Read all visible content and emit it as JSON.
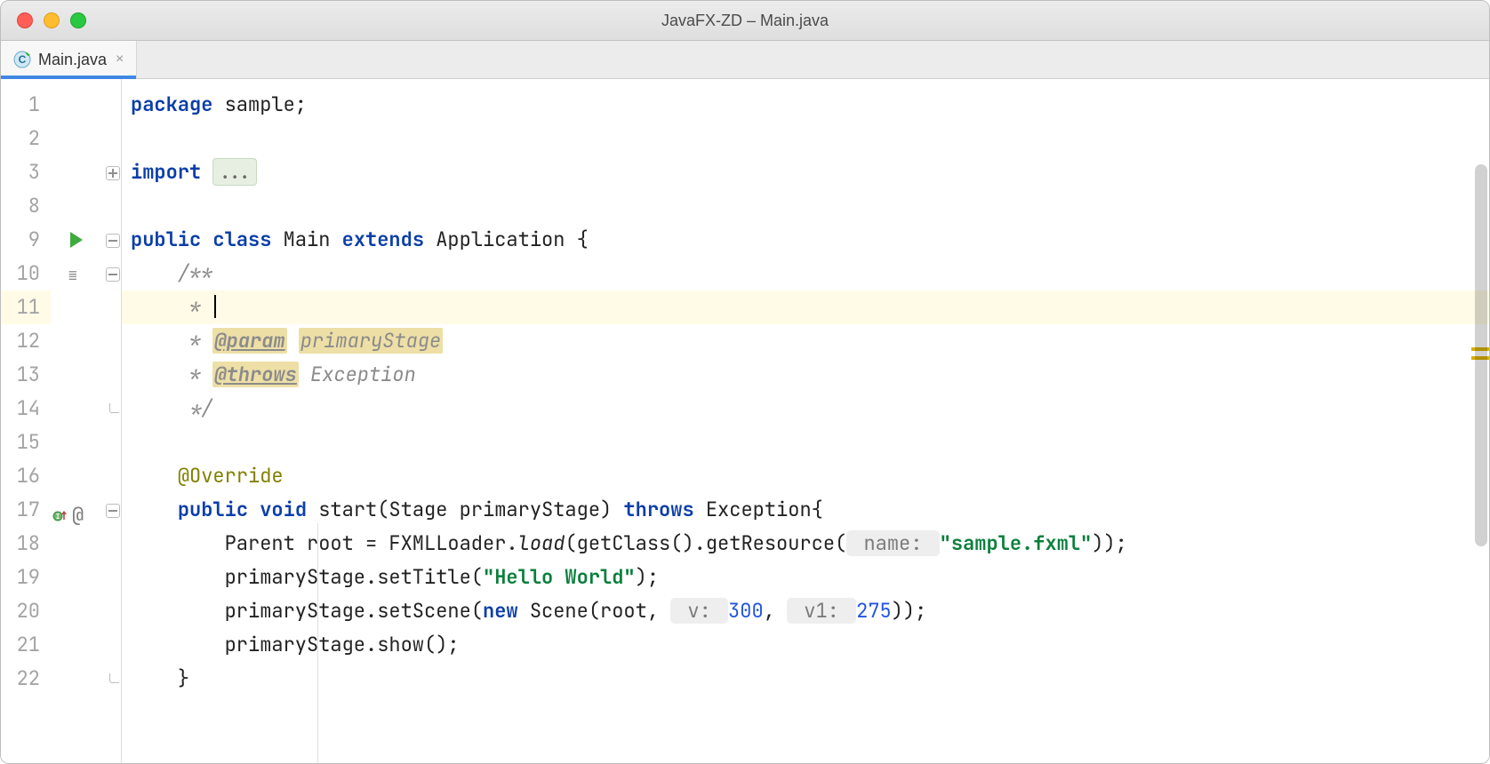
{
  "window": {
    "title": "JavaFX-ZD – Main.java"
  },
  "tab": {
    "label": "Main.java"
  },
  "lineNumbers": [
    "1",
    "2",
    "3",
    "8",
    "9",
    "10",
    "11",
    "12",
    "13",
    "14",
    "15",
    "16",
    "17",
    "18",
    "19",
    "20",
    "21",
    "22"
  ],
  "code": {
    "pkgKw": "package",
    "pkgName": " sample;",
    "importKw": "import",
    "importFolded": "...",
    "cls_public": "public",
    "cls_class": "class",
    "cls_name": " Main ",
    "cls_extends": "extends",
    "cls_super": " Application {",
    "doc_open": "/**",
    "doc_star": " * ",
    "doc_param_tag": "@param",
    "doc_param_name": "primaryStage",
    "doc_throws_tag": "@throws",
    "doc_throws_name": " Exception",
    "doc_close": " */",
    "override": "@Override",
    "m_public": "public",
    "m_void": "void",
    "m_sig": " start(Stage primaryStage) ",
    "m_throws": "throws",
    "m_throws_ex": " Exception{",
    "l18_a": "Parent root = FXMLLoader.",
    "l18_load": "load",
    "l18_b": "(getClass().getResource(",
    "l18_hint": " name: ",
    "l18_str": "\"sample.fxml\"",
    "l18_c": "));",
    "l19_a": "primaryStage.setTitle(",
    "l19_str": "\"Hello World\"",
    "l19_b": ");",
    "l20_a": "primaryStage.setScene(",
    "l20_new": "new",
    "l20_b": " Scene(root, ",
    "l20_h1": " v: ",
    "l20_n1": "300",
    "l20_c": ", ",
    "l20_h2": " v1: ",
    "l20_n2": "275",
    "l20_d": "));",
    "l21": "primaryStage.show();",
    "l22": "}"
  }
}
